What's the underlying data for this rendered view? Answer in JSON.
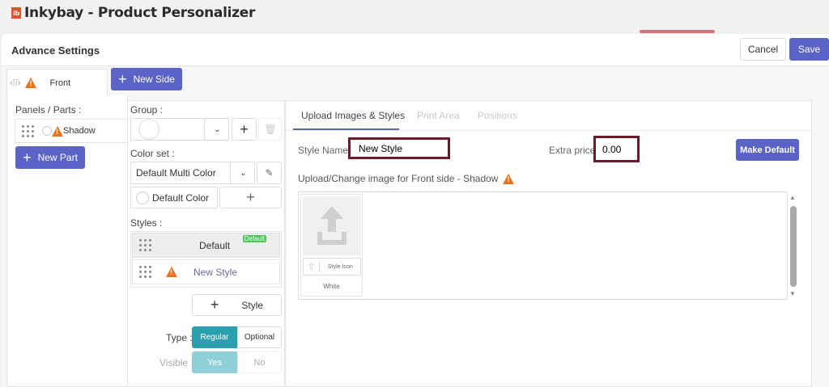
{
  "app": {
    "logo_text": "ib",
    "title": "Inkybay - Product Personalizer"
  },
  "modal": {
    "title": "Advance Settings",
    "cancel": "Cancel",
    "save": "Save"
  },
  "sides": {
    "active": "Front",
    "new_side": "New Side"
  },
  "panels": {
    "label": "Panels / Parts :",
    "items": [
      {
        "name": "Shadow"
      }
    ],
    "new_part": "New Part"
  },
  "group": {
    "label": "Group :"
  },
  "color_set": {
    "label": "Color set :",
    "value": "Default Multi Color",
    "default_color": "Default Color"
  },
  "styles": {
    "label": "Styles :",
    "items": [
      {
        "name": "Default",
        "badge": "Default"
      },
      {
        "name": "New Style"
      }
    ],
    "add": "Style"
  },
  "type": {
    "label": "Type :",
    "options": [
      "Regular",
      "Optional"
    ],
    "selected": "Regular"
  },
  "visible": {
    "label": "Visible :",
    "options": [
      "Yes",
      "No"
    ],
    "selected": "Yes"
  },
  "tabs": [
    "Upload Images & Styles",
    "Print Area",
    "Positions"
  ],
  "style_form": {
    "name_label": "Style Name :",
    "name_value": "New Style",
    "price_label": "Extra price:",
    "price_value": "0.00",
    "make_default": "Make Default"
  },
  "upload": {
    "label": "Upload/Change image for Front side - Shadow",
    "style_icon": "Style Icon",
    "color_name": "White"
  },
  "colors": {
    "primary": "#5b63c7",
    "teal": "#2a9fad",
    "highlight": "#6b1a2a"
  }
}
